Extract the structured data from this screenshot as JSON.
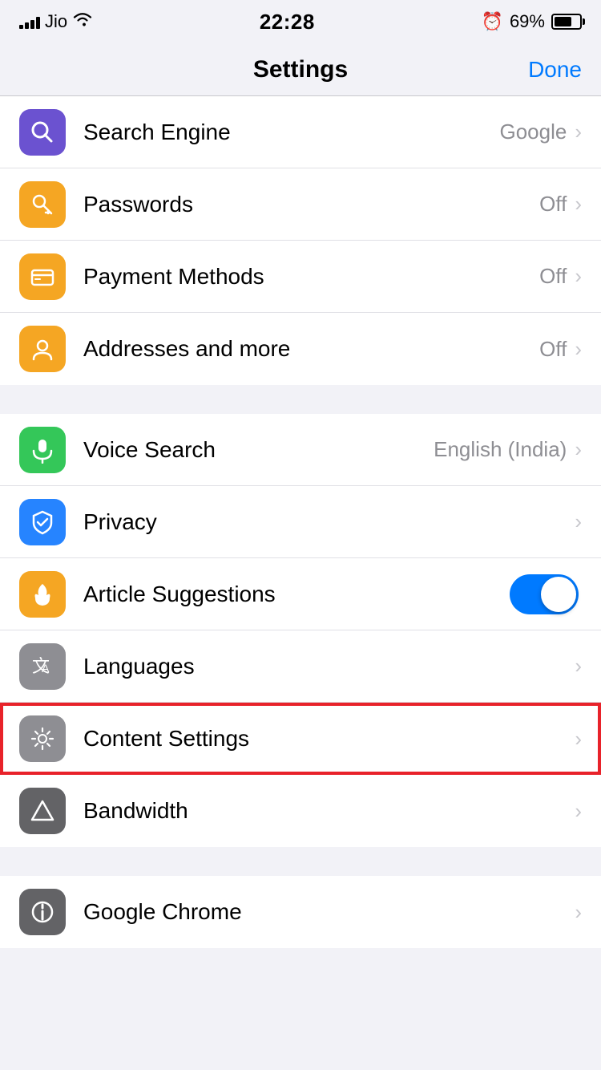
{
  "statusBar": {
    "carrier": "Jio",
    "time": "22:28",
    "battery": "69%"
  },
  "nav": {
    "title": "Settings",
    "done": "Done"
  },
  "sections": [
    {
      "id": "section1",
      "rows": [
        {
          "id": "search-engine",
          "label": "Search Engine",
          "value": "Google",
          "hasChevron": true,
          "icon": "search",
          "iconColor": "purple"
        },
        {
          "id": "passwords",
          "label": "Passwords",
          "value": "Off",
          "hasChevron": true,
          "icon": "key",
          "iconColor": "orange-key"
        },
        {
          "id": "payment-methods",
          "label": "Payment Methods",
          "value": "Off",
          "hasChevron": true,
          "icon": "card",
          "iconColor": "orange-card"
        },
        {
          "id": "addresses",
          "label": "Addresses and more",
          "value": "Off",
          "hasChevron": true,
          "icon": "person",
          "iconColor": "orange-addr"
        }
      ]
    },
    {
      "id": "section2",
      "rows": [
        {
          "id": "voice-search",
          "label": "Voice Search",
          "value": "English (India)",
          "hasChevron": true,
          "icon": "mic",
          "iconColor": "green"
        },
        {
          "id": "privacy",
          "label": "Privacy",
          "value": "",
          "hasChevron": true,
          "icon": "shield",
          "iconColor": "blue-shield"
        },
        {
          "id": "article-suggestions",
          "label": "Article Suggestions",
          "value": "",
          "hasChevron": false,
          "hasToggle": true,
          "icon": "fire",
          "iconColor": "orange-fire"
        },
        {
          "id": "languages",
          "label": "Languages",
          "value": "",
          "hasChevron": true,
          "icon": "lang",
          "iconColor": "gray-lang"
        },
        {
          "id": "content-settings",
          "label": "Content Settings",
          "value": "",
          "hasChevron": true,
          "icon": "gear",
          "iconColor": "gray-gear",
          "highlighted": true
        },
        {
          "id": "bandwidth",
          "label": "Bandwidth",
          "value": "",
          "hasChevron": true,
          "icon": "triangle",
          "iconColor": "gray-tri"
        }
      ]
    },
    {
      "id": "section3",
      "rows": [
        {
          "id": "google-chrome",
          "label": "Google Chrome",
          "value": "",
          "hasChevron": true,
          "icon": "info",
          "iconColor": "gray-info"
        }
      ]
    }
  ]
}
